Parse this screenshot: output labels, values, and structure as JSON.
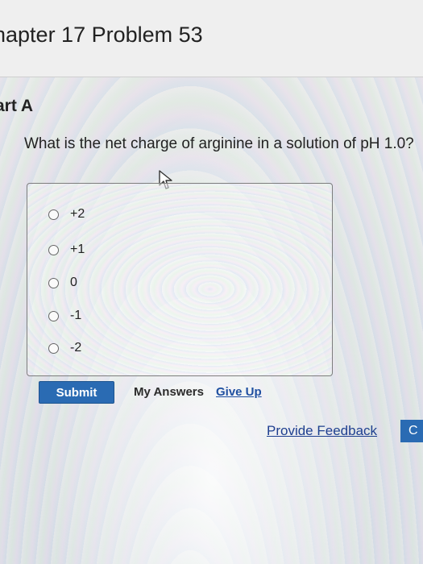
{
  "header": {
    "chapter_title": "hapter 17 Problem 53"
  },
  "part": {
    "label": "art A"
  },
  "question": {
    "text": "What is the net charge of arginine in a solution of pH 1.0?"
  },
  "options": [
    {
      "label": "+2"
    },
    {
      "label": "+1"
    },
    {
      "label": "0"
    },
    {
      "label": "-1"
    },
    {
      "label": "-2"
    }
  ],
  "actions": {
    "submit_label": "Submit",
    "my_answers_label": "My Answers",
    "give_up_label": "Give Up",
    "feedback_label": "Provide Feedback",
    "continue_label": "C"
  },
  "colors": {
    "primary_button": "#2a6bb3",
    "link": "#1f4fa0"
  }
}
